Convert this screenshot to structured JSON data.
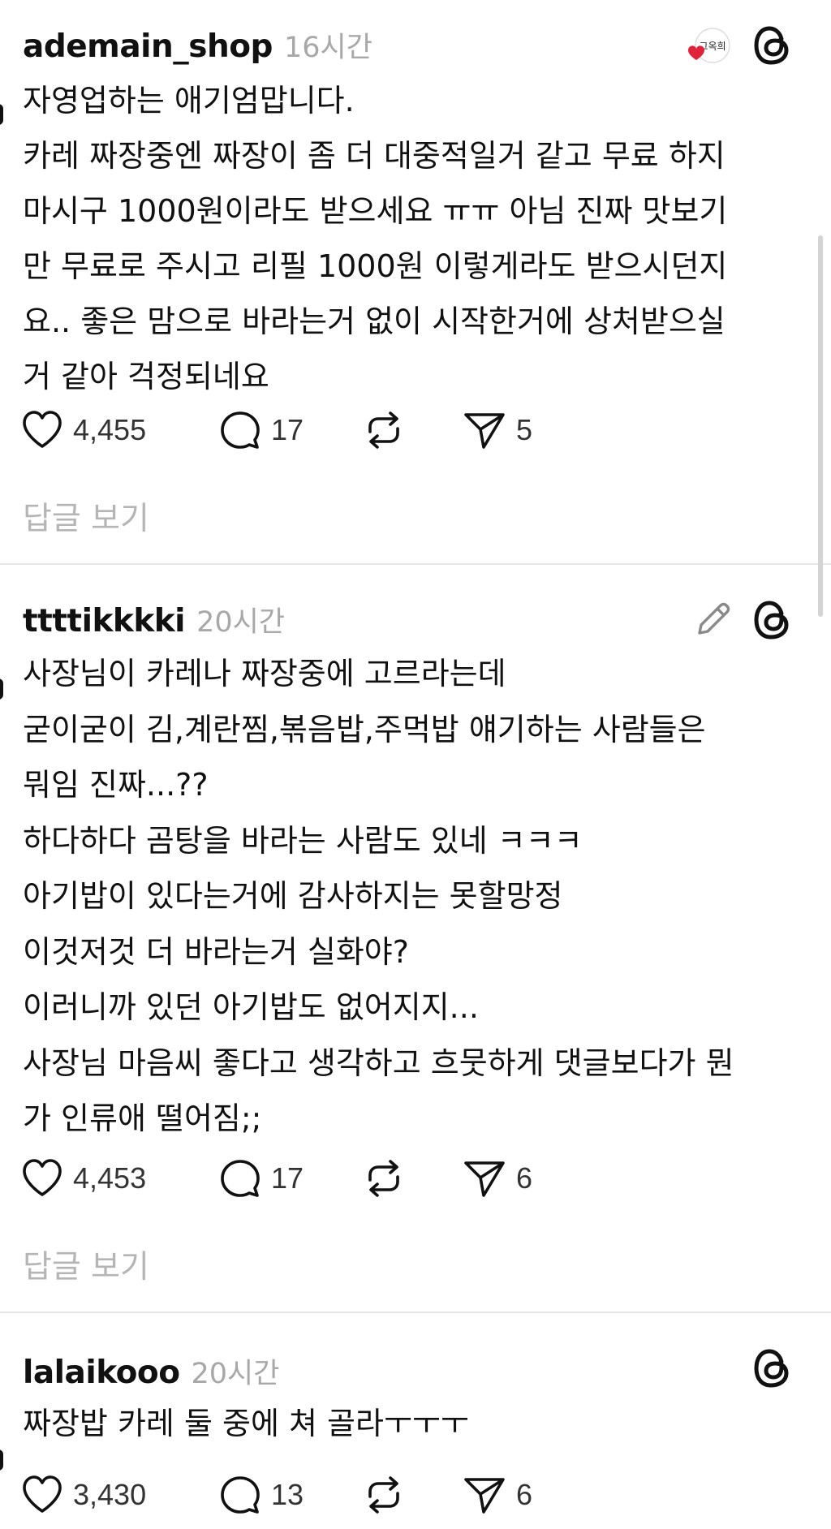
{
  "posts": [
    {
      "username": "ademain_shop",
      "time": "16시간",
      "lines": [
        "자영업하는 애기엄맙니다.",
        "카레 짜장중엔 짜장이 좀 더 대중적일거 같고 무료 하지",
        "마시구 1000원이라도 받으세요 ㅠㅠ 아님 진짜 맛보기",
        "만 무료로 주시고 리필 1000원 이렇게라도 받으시던지",
        "요.. 좋은 맘으로 바라는거 없이 시작한거에 상처받으실",
        "거 같아 걱정되네요"
      ],
      "likes": "4,455",
      "comments": "17",
      "shares": "5",
      "view_replies": "답글 보기",
      "badge_text": "그옥희"
    },
    {
      "username": "ttttikkkki",
      "time": "20시간",
      "lines": [
        "사장님이 카레나 짜장중에 고르라는데",
        "굳이굳이 김,계란찜,볶음밥,주먹밥 얘기하는 사람들은",
        "뭐임 진짜...??",
        "하다하다 곰탕을 바라는 사람도 있네 ㅋㅋㅋ",
        "아기밥이 있다는거에 감사하지는 못할망정",
        "이것저것 더 바라는거 실화야?",
        "이러니까 있던 아기밥도 없어지지...",
        "사장님 마음씨 좋다고 생각하고 흐뭇하게 댓글보다가 뭔",
        "가 인류애 떨어짐;;"
      ],
      "likes": "4,453",
      "comments": "17",
      "shares": "6",
      "view_replies": "답글 보기"
    },
    {
      "username": "lalaikooo",
      "time": "20시간",
      "lines": [
        "짜장밥 카레 둘 중에 쳐 골라ㅜㅜㅜ"
      ],
      "likes": "3,430",
      "comments": "13",
      "shares": "6"
    }
  ],
  "icons": {
    "threads": "threads-logo-icon",
    "like": "heart-icon",
    "comment": "comment-bubble-icon",
    "repost": "repost-icon",
    "share": "send-icon",
    "edit": "pencil-icon",
    "badge": "profile-badge-icon"
  },
  "colors": {
    "text": "#111111",
    "muted": "#a8a8a8",
    "divider": "#e6e6e6",
    "badge_heart": "#e0223a"
  }
}
